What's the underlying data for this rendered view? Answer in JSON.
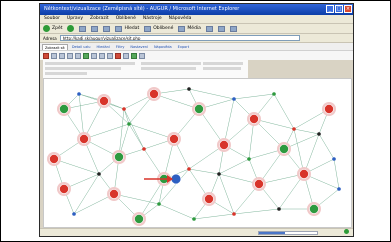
{
  "window": {
    "title": "Nětkontext/vizualizace (Zeměpisná sítě) - AUGUR / Microsoft Internet Explorer"
  },
  "menubar": {
    "items": [
      "Soubor",
      "Úpravy",
      "Zobrazit",
      "Oblíbené",
      "Nástroje",
      "Nápověda"
    ]
  },
  "nav": {
    "back_label": "Zpět",
    "search_label": "Hledat",
    "favorites_label": "Oblíbené",
    "media_label": "Média"
  },
  "address": {
    "label": "Adresa",
    "url": "http://kadi.sk/augur/vizualizace/sit.php"
  },
  "app_tabs": [
    "Zobrazit sít",
    "Detail uzlu",
    "Hledání",
    "Filtry",
    "Nastavení",
    "Nápověda",
    "Export"
  ],
  "canvas": {
    "node_colors": {
      "red": "#d8342a",
      "green": "#2e9a3f",
      "blue": "#2d5fc2",
      "halo": "#f1c9c9",
      "edge": "#7fb59b"
    },
    "selected_node_icon": "person-icon",
    "pointer_icon": "red-arrow-icon"
  },
  "status": {
    "progress": 0.45,
    "zone_icon": "globe-icon"
  }
}
